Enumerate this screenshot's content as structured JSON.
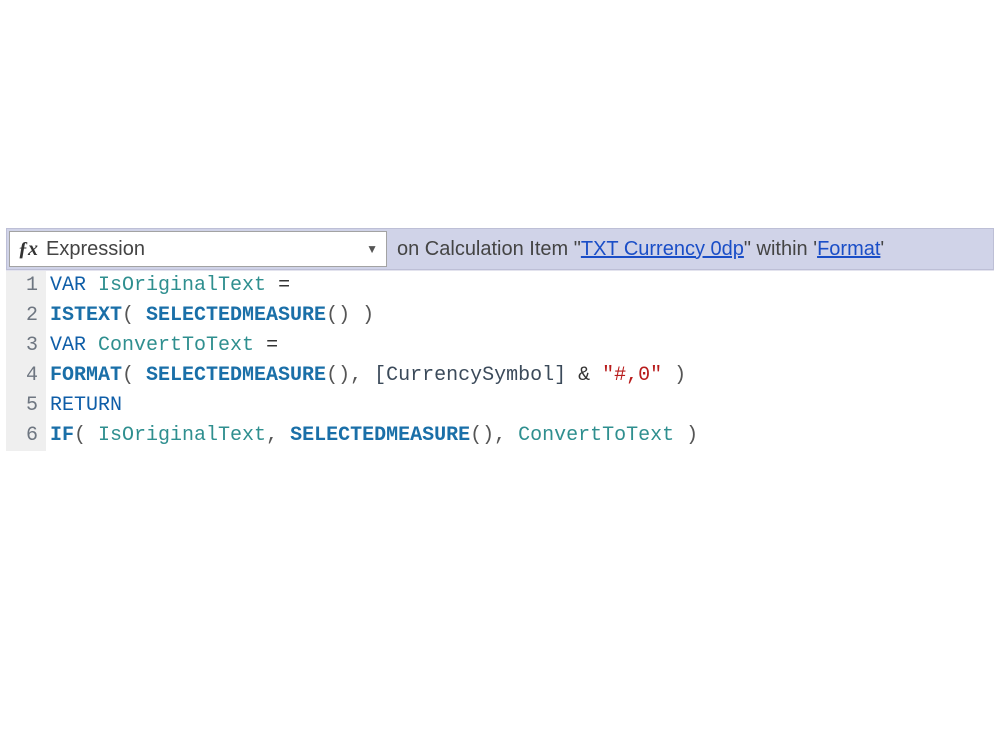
{
  "header": {
    "fx": "ƒx",
    "selector": "Expression",
    "context_prefix": "on Calculation Item \"",
    "item_link": "TXT Currency 0dp",
    "context_mid": "\" within '",
    "within_link": " Format",
    "context_suffix": "'"
  },
  "gutter": [
    "1",
    "2",
    "3",
    "4",
    "5",
    "6"
  ],
  "code": {
    "l1": {
      "indent": "    ",
      "kw": "VAR",
      "sp": " ",
      "id": "IsOriginalText",
      "eq": " ="
    },
    "l2": {
      "indent": "        ",
      "fn": "ISTEXT",
      "p1": "( ",
      "fn2": "SELECTEDMEASURE",
      "p2": "() )"
    },
    "l3": {
      "indent": "    ",
      "kw": "VAR",
      "sp": " ",
      "id": "ConvertToText",
      "eq": " ="
    },
    "l4": {
      "indent": "        ",
      "fn": "FORMAT",
      "p1": "( ",
      "fn2": "SELECTEDMEASURE",
      "p2": "(), ",
      "mb": "[CurrencySymbol]",
      "amp": " & ",
      "st": "\"#,0\"",
      "p3": " )"
    },
    "l5": {
      "indent": "    ",
      "kw": "RETURN"
    },
    "l6": {
      "indent": "        ",
      "fn": "IF",
      "p1": "( ",
      "id1": "IsOriginalText",
      "c1": ", ",
      "fn2": "SELECTEDMEASURE",
      "p2": "(), ",
      "id2": "ConvertToText",
      "p3": " )"
    }
  }
}
